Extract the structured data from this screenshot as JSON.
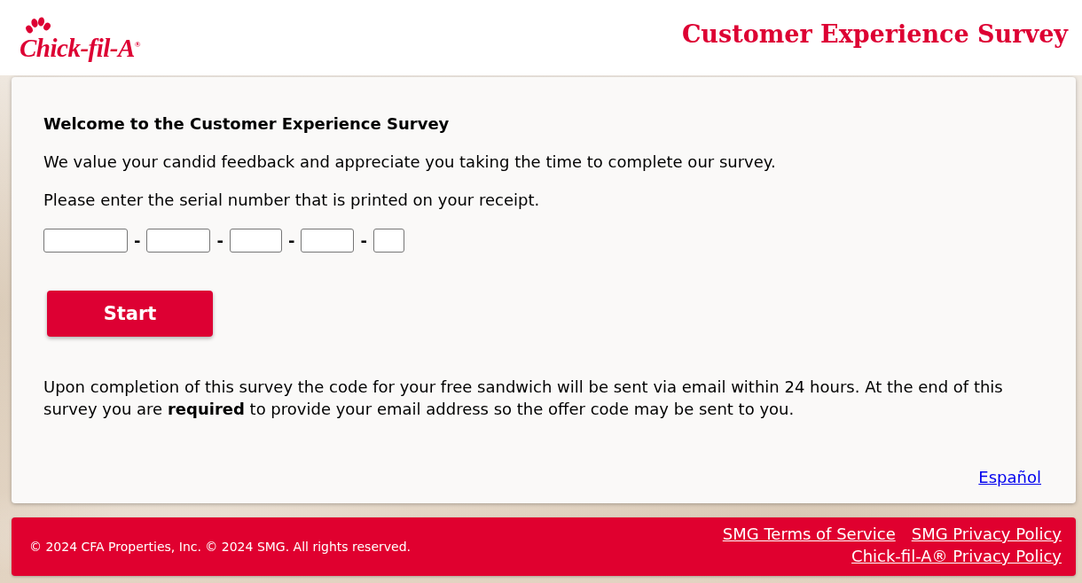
{
  "header": {
    "logo": {
      "wordmark": "Chick-fil-A$^{®}$"
    },
    "title": "Customer Experience Survey"
  },
  "card": {
    "heading": "Welcome to the Customer Experience Survey",
    "intro": "We value your candid feedback and appreciate you taking the time to complete our survey.",
    "prompt": "Please enter the serial number that is printed on your receipt.",
    "serial_number": [
      {
        "kind": "input"
      },
      {
        "kind": "separator",
        "text": "-"
      },
      {
        "kind": "input"
      },
      {
        "kind": "separator",
        "text": "-"
      },
      {
        "kind": "input"
      },
      {
        "kind": "separator",
        "text": "-"
      },
      {
        "kind": "input"
      },
      {
        "kind": "separator",
        "text": "-"
      },
      {
        "kind": "input"
      }
    ],
    "start_button": "Start",
    "notice": "Upon completion of this survey the code for your free sandwich will be sent via email within 24 hours. At the end of this survey you are **required** to provide your email address so the offer code may be sent to you.",
    "language_link": "Español"
  },
  "footer": {
    "copyright": "© 2024 CFA Properties, Inc. © 2024 SMG. All rights reserved.",
    "links": [
      "SMG Terms of Service",
      "SMG Privacy Policy",
      "Chick-fil-A® Privacy Policy"
    ]
  }
}
